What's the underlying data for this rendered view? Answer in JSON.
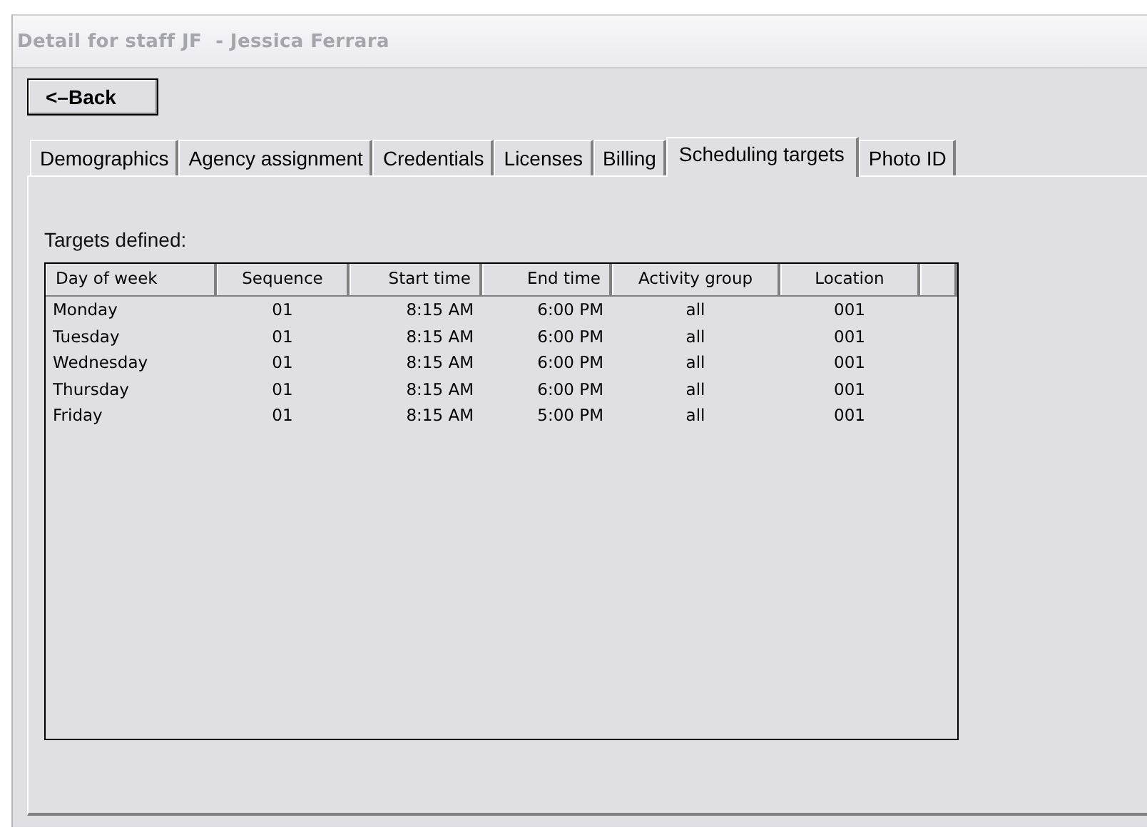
{
  "window": {
    "title": "Detail for staff JF  - Jessica Ferrara"
  },
  "back_button": {
    "label": "<–Back"
  },
  "tabs": [
    {
      "label": "Demographics",
      "selected": false
    },
    {
      "label": "Agency assignment",
      "selected": false
    },
    {
      "label": "Credentials",
      "selected": false
    },
    {
      "label": "Licenses",
      "selected": false
    },
    {
      "label": "Billing",
      "selected": false
    },
    {
      "label": "Scheduling targets",
      "selected": true
    },
    {
      "label": "Photo ID",
      "selected": false
    }
  ],
  "targets_label": "Targets defined:",
  "table": {
    "columns": [
      "Day of week",
      "Sequence",
      "Start time",
      "End time",
      "Activity group",
      "Location"
    ],
    "rows": [
      [
        "Monday",
        "01",
        "8:15 AM",
        "6:00 PM",
        "all",
        "001"
      ],
      [
        "Tuesday",
        "01",
        "8:15 AM",
        "6:00 PM",
        "all",
        "001"
      ],
      [
        "Wednesday",
        "01",
        "8:15 AM",
        "6:00 PM",
        "all",
        "001"
      ],
      [
        "Thursday",
        "01",
        "8:15 AM",
        "6:00 PM",
        "all",
        "001"
      ],
      [
        "Friday",
        "01",
        "8:15 AM",
        "5:00 PM",
        "all",
        "001"
      ]
    ]
  }
}
